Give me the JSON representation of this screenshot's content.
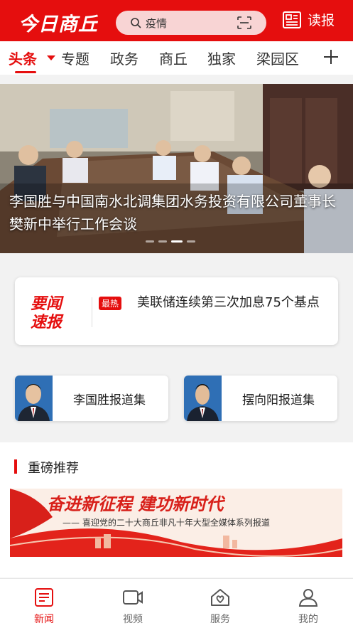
{
  "header": {
    "logo_text": "今日商丘",
    "search_text": "疫情",
    "read_label": "读报"
  },
  "tabs": [
    {
      "label": "头条",
      "active": true
    },
    {
      "label": "专题"
    },
    {
      "label": "政务"
    },
    {
      "label": "商丘"
    },
    {
      "label": "独家"
    },
    {
      "label": "梁园区"
    }
  ],
  "hero": {
    "title": "李国胜与中国南水北调集团水务投资有限公司董事长樊新中举行工作会谈",
    "slide_count": 4,
    "active_slide": 3
  },
  "breaking": {
    "brand_line1": "要闻",
    "brand_line2": "速报",
    "badge": "最热",
    "text": "美联储连续第三次加息75个基点"
  },
  "collections": [
    {
      "label": "李国胜报道集"
    },
    {
      "label": "摆向阳报道集"
    }
  ],
  "featured": {
    "title": "重磅推荐",
    "banner_main": "奋进新征程  建功新时代",
    "banner_sub": "—— 喜迎党的二十大商丘非凡十年大型全媒体系列报道"
  },
  "bottom_nav": [
    {
      "label": "新闻",
      "icon": "news-icon",
      "active": true
    },
    {
      "label": "视频",
      "icon": "video-icon"
    },
    {
      "label": "服务",
      "icon": "service-icon"
    },
    {
      "label": "我的",
      "icon": "profile-icon"
    }
  ],
  "colors": {
    "brand_red": "#e50e0e",
    "background": "#f2f2f2"
  }
}
